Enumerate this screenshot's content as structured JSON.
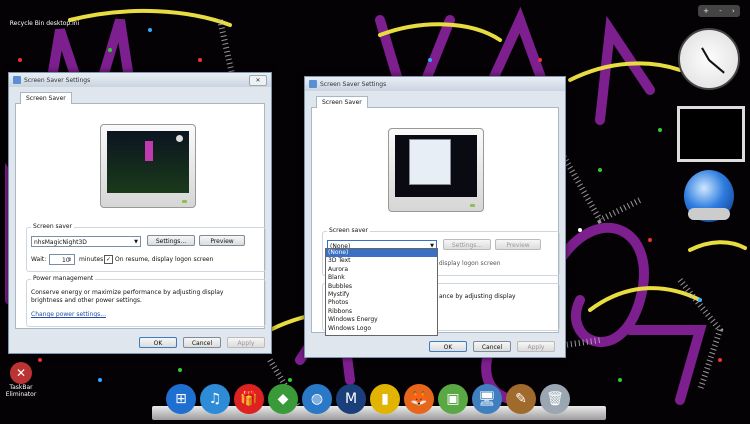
{
  "desktop": {
    "top_icon_label": "Recycle Bin  desktop.ini",
    "bottom_icon_label": "TaskBar Eliminator"
  },
  "gadget_bar": {
    "plus": "+",
    "minus": "-",
    "more": "›"
  },
  "window_left": {
    "title": "Screen Saver Settings",
    "tab": "Screen Saver",
    "screensaver_group_label": "Screen saver",
    "screensaver_value": "nhsMagicNight3D",
    "settings_button": "Settings...",
    "preview_button": "Preview",
    "wait_label": "Wait:",
    "wait_value": "10",
    "minutes_label": "minutes",
    "resume_checkbox_label": "On resume, display logon screen",
    "power_group_label": "Power management",
    "power_text_1": "Conserve energy or maximize performance by adjusting display",
    "power_text_2": "brightness and other power settings.",
    "power_link": "Change power settings...",
    "ok": "OK",
    "cancel": "Cancel",
    "apply": "Apply"
  },
  "window_right": {
    "title": "Screen Saver Settings",
    "tab": "Screen Saver",
    "screensaver_group_label": "Screen saver",
    "screensaver_value": "(None)",
    "settings_button": "Settings...",
    "preview_button": "Preview",
    "resume_partial": ", display logon screen",
    "power_partial": "ance by adjusting display",
    "ok": "OK",
    "cancel": "Cancel",
    "apply": "Apply",
    "dropdown_options": [
      "(None)",
      "3D Text",
      "Aurora",
      "Blank",
      "Bubbles",
      "Mystify",
      "Photos",
      "Ribbons",
      "Windows Energy",
      "Windows Logo"
    ],
    "dropdown_selected": "(None)"
  },
  "dock_icons": [
    {
      "name": "windows-start-icon",
      "color": "#1e6fd0"
    },
    {
      "name": "itunes-icon",
      "color": "#2d8bd8"
    },
    {
      "name": "gift-app-icon",
      "color": "#d22"
    },
    {
      "name": "sims-plumbob-icon",
      "color": "#3a9a3a"
    },
    {
      "name": "globe-icon",
      "color": "#2a78c8"
    },
    {
      "name": "malwarebytes-icon",
      "color": "#1a3f7a"
    },
    {
      "name": "usb-safely-remove-icon",
      "color": "#e0b400"
    },
    {
      "name": "firefox-icon",
      "color": "#e8661a"
    },
    {
      "name": "picture-viewer-icon",
      "color": "#5aa843"
    },
    {
      "name": "network-computer-icon",
      "color": "#3f7fbf"
    },
    {
      "name": "paint-brushes-icon",
      "color": "#a06a2c"
    },
    {
      "name": "recycle-bin-icon",
      "color": "#9aa6b2"
    }
  ]
}
